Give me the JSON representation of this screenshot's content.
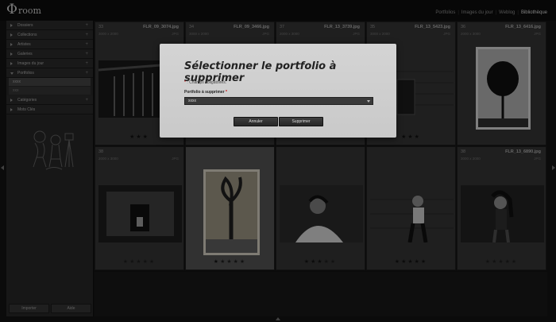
{
  "app": {
    "logo_mark": "Φ",
    "logo_name": "room"
  },
  "topnav": {
    "items": [
      {
        "label": "Portfolios"
      },
      {
        "label": "Images du jour"
      },
      {
        "label": "Weblog"
      },
      {
        "label": "Bibliothèque"
      }
    ]
  },
  "sidebar": {
    "items": [
      {
        "label": "Dossiers"
      },
      {
        "label": "Collections"
      },
      {
        "label": "Artistes"
      },
      {
        "label": "Galeries"
      },
      {
        "label": "Images du jour"
      },
      {
        "label": "Portfolios"
      },
      {
        "label": "Catégories"
      },
      {
        "label": "Mots Clés"
      }
    ],
    "portfolio_sub": [
      "xxxx",
      "xxx"
    ],
    "buttons": {
      "import": "Importer",
      "help": "Aide"
    }
  },
  "grid": {
    "cells": [
      {
        "num": "33",
        "fname": "FLR_09_3074.jpg",
        "dims": "3000 x 2000",
        "tag": "JPG",
        "rating": 3
      },
      {
        "num": "34",
        "fname": "FLR_09_3466.jpg",
        "dims": "3000 x 2000",
        "tag": "JPG",
        "rating": 0
      },
      {
        "num": "37",
        "fname": "FLR_13_3739.jpg",
        "dims": "2000 x 3000",
        "tag": "JPG",
        "rating": 0
      },
      {
        "num": "35",
        "fname": "FLR_13_5423.jpg",
        "dims": "3000 x 2000",
        "tag": "JPG",
        "rating": 3
      },
      {
        "num": "36",
        "fname": "FLR_13_6416.jpg",
        "dims": "2000 x 3000",
        "tag": "JPG",
        "rating": 0
      },
      {
        "num": "38",
        "fname": "",
        "dims": "2000 x 3000",
        "tag": "JPG",
        "rating": 0
      },
      {
        "num": "",
        "fname": "",
        "dims": "",
        "tag": "",
        "rating": 1
      },
      {
        "num": "",
        "fname": "",
        "dims": "",
        "tag": "",
        "rating": 3
      },
      {
        "num": "",
        "fname": "",
        "dims": "",
        "tag": "",
        "rating": 5
      },
      {
        "num": "38",
        "fname": "FLR_13_6890.jpg",
        "dims": "3000 x 2000",
        "tag": "JPG",
        "rating": 0
      }
    ]
  },
  "modal": {
    "title": "Sélectionner le portfolio à supprimer",
    "required_note": ": Champs obligatoires.",
    "required_star": "*",
    "field_label": "Portfolio à supprimer",
    "select_value": "xxxx",
    "cancel": "Annuler",
    "delete": "Supprimer"
  },
  "colors": {
    "accent_required": "#cc0000",
    "modal_bg": "#d0d0d0"
  }
}
